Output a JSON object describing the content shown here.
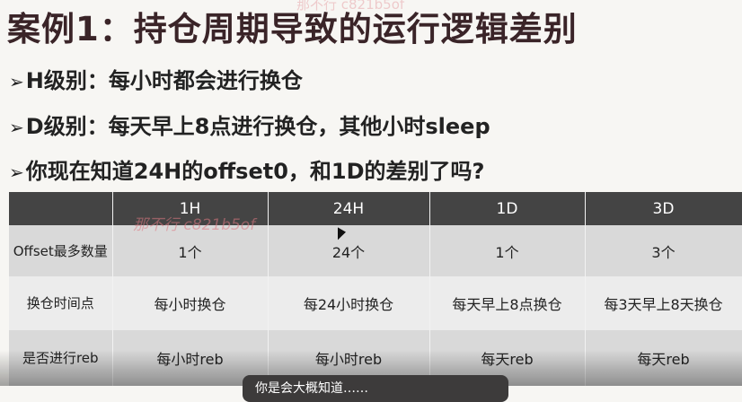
{
  "title": "案例1：持仓周期导致的运行逻辑差别",
  "bullets": [
    "H级别：每小时都会进行换仓",
    "D级别：每天早上8点进行换仓，其他小时sleep",
    "你现在知道24H的offset0，和1D的差别了吗?"
  ],
  "bullet_marker": "➢",
  "table": {
    "headers": [
      "",
      "1H",
      "24H",
      "1D",
      "3D"
    ],
    "rows": [
      {
        "label": "Offset最多数量",
        "cells": [
          "1个",
          "24个",
          "1个",
          "3个"
        ]
      },
      {
        "label": "换仓时间点",
        "cells": [
          "每小时换仓",
          "每24小时换仓",
          "每天早上8点换仓",
          "每3天早上8天换仓"
        ]
      },
      {
        "label": "是否进行reb",
        "cells": [
          "每小时reb",
          "每小时reb",
          "每天reb",
          "每天reb"
        ]
      }
    ]
  },
  "watermark": "那不行 c821b5of",
  "caption": "你是会大概知道……"
}
